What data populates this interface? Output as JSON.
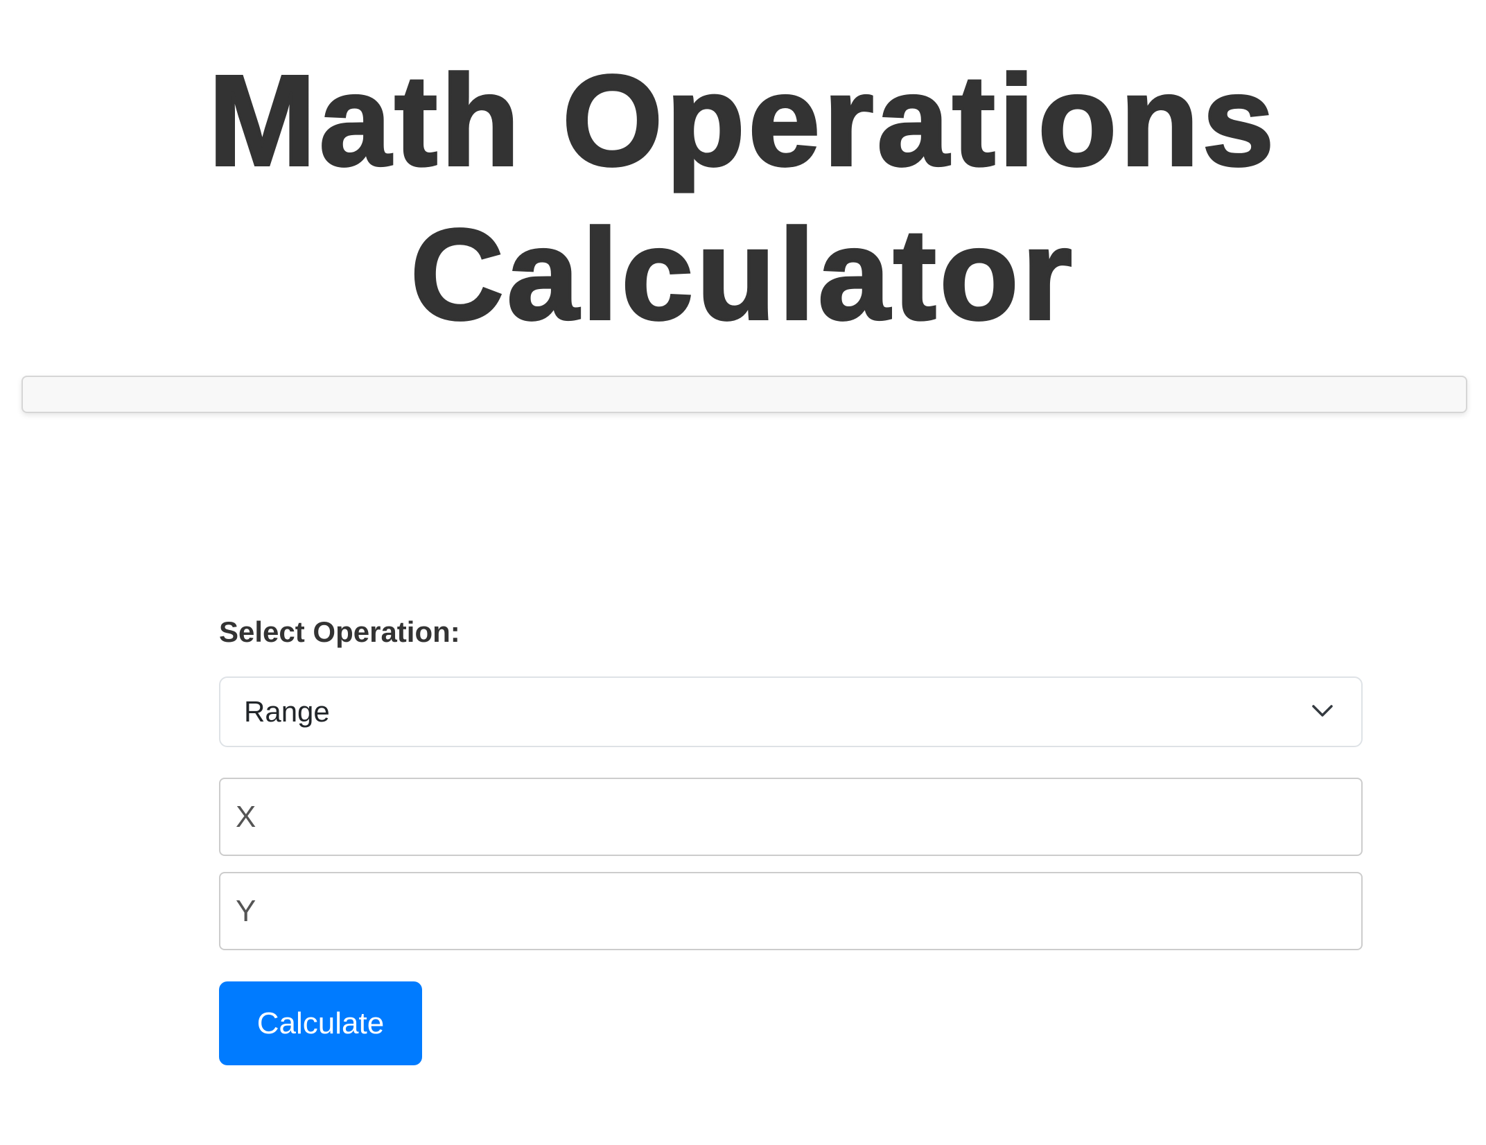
{
  "header": {
    "title": "Math Operations Calculator"
  },
  "result": {
    "text": ""
  },
  "form": {
    "operation_label": "Select Operation:",
    "operation_selected": "Range",
    "x_placeholder": "X",
    "y_placeholder": "Y",
    "calculate_label": "Calculate"
  },
  "colors": {
    "accent": "#007bff",
    "text": "#333333",
    "result_bg": "#f8f8f8"
  },
  "icons": {
    "select_indicator": "chevron-down-icon"
  }
}
